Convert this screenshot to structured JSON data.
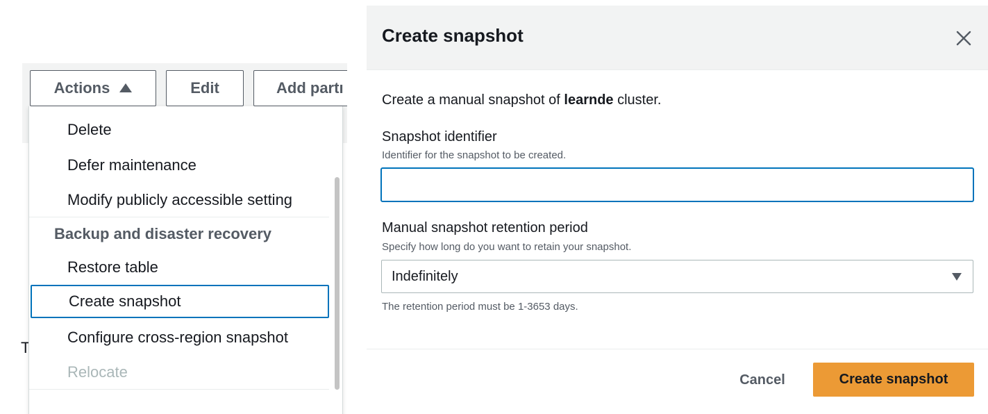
{
  "toolbar": {
    "actions_label": "Actions",
    "edit_label": "Edit",
    "add_partition_label": "Add partı"
  },
  "stray_text": "T",
  "menu": {
    "items_top": [
      "Delete",
      "Defer maintenance",
      "Modify publicly accessible setting"
    ],
    "group_header": "Backup and disaster recovery",
    "items_group": [
      "Restore table",
      "Create snapshot",
      "Configure cross-region snapshot",
      "Relocate"
    ],
    "focused_item": "Create snapshot",
    "disabled_item": "Relocate"
  },
  "modal": {
    "title": "Create snapshot",
    "intro_prefix": "Create a manual snapshot of ",
    "intro_cluster": "learnde",
    "intro_suffix": " cluster.",
    "snapshot_identifier": {
      "label": "Snapshot identifier",
      "description": "Identifier for the snapshot to be created.",
      "value": ""
    },
    "retention": {
      "label": "Manual snapshot retention period",
      "description": "Specify how long do you want to retain your snapshot.",
      "selected": "Indefinitely",
      "hint": "The retention period must be 1-3653 days."
    },
    "cancel_label": "Cancel",
    "submit_label": "Create snapshot"
  },
  "colors": {
    "primary_button": "#ec9a35",
    "focus_border": "#0073bb",
    "header_bg": "#f2f3f3"
  },
  "icons": {
    "close": "close-icon",
    "actions_caret": "caret-up-icon",
    "select_caret": "caret-down-icon"
  }
}
